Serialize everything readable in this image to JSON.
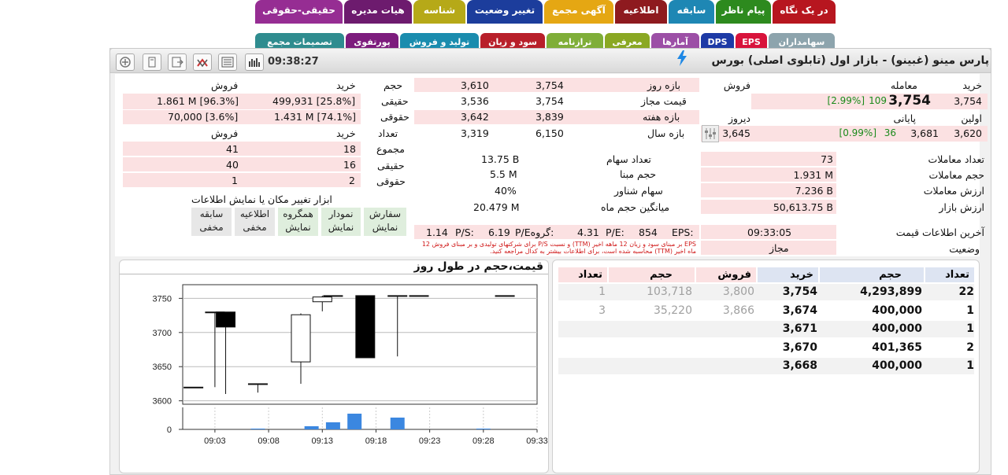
{
  "tabs_row1": [
    {
      "label": "در یک نگاه",
      "color": "#b7161f"
    },
    {
      "label": "پیام ناظر",
      "color": "#2d8a1e"
    },
    {
      "label": "سابقه",
      "color": "#1e87b4"
    },
    {
      "label": "اطلاعیه",
      "color": "#8e1a1f"
    },
    {
      "label": "آگهی مجمع",
      "color": "#e5a713"
    },
    {
      "label": "تغییر وضعیت",
      "color": "#1c3d9c"
    },
    {
      "label": "شناسه",
      "color": "#b6a918"
    },
    {
      "label": "هیات مدیره",
      "color": "#6d1b6e"
    },
    {
      "label": "حقیقی-حقوقی",
      "color": "#962d93"
    }
  ],
  "tabs_row2": [
    {
      "label": "سهامداران",
      "color": "#8da4ad"
    },
    {
      "label": "EPS",
      "color": "#d8133b"
    },
    {
      "label": "DPS",
      "color": "#1d3aa6"
    },
    {
      "label": "آمارها",
      "color": "#9c4fa6"
    },
    {
      "label": "معرفی",
      "color": "#8aa823"
    },
    {
      "label": "ترازنامه",
      "color": "#7fae38"
    },
    {
      "label": "سود و زیان",
      "color": "#b81f2a"
    },
    {
      "label": "تولید و فروش",
      "color": "#1a8cae"
    },
    {
      "label": "پورتفوی",
      "color": "#7d1c7d"
    },
    {
      "label": "تصمیمات مجمع",
      "color": "#2f8c8f"
    }
  ],
  "header": {
    "title": "پارس مینو (غبینو) - بازار اول (تابلوی اصلی) بورس",
    "time": "09:38:27"
  },
  "price_panel": {
    "buy": "خرید",
    "trade": "معامله",
    "sell": "فروش",
    "buy_val": "3,754",
    "trade_val": "3,754",
    "trade_change": "109",
    "trade_pct": "[2.99%]",
    "first": "اولین",
    "closing": "پایانی",
    "yesterday": "دیروز",
    "first_val": "3,620",
    "closing_val": "3,681",
    "closing_change": "36",
    "closing_pct": "[0.99%]",
    "yesterday_val": "3,645"
  },
  "range_panel": {
    "rows": [
      {
        "label": "بازه روز",
        "a": "3,754",
        "b": "3,610"
      },
      {
        "label": "قیمت مجاز",
        "a": "3,754",
        "b": "3,536"
      },
      {
        "label": "بازه هفته",
        "a": "3,839",
        "b": "3,642"
      },
      {
        "label": "بازه سال",
        "a": "6,150",
        "b": "3,319"
      }
    ]
  },
  "volume_header": {
    "volume": "حجم",
    "buy": "خرید",
    "sell": "فروش"
  },
  "real_legal": {
    "real": "حقیقی",
    "legal": "حقوقی",
    "real_buy": "499,931 [25.8%]",
    "real_sell": "1.861 M [96.3%]",
    "legal_buy": "1.431 M [74.1%]",
    "legal_sell": "70,000 [3.6%]"
  },
  "count_table": {
    "count": "تعداد",
    "buy": "خرید",
    "sell": "فروش",
    "rows": [
      {
        "label": "مجموع",
        "buy": "18",
        "sell": "41"
      },
      {
        "label": "حقیقی",
        "buy": "16",
        "sell": "40"
      },
      {
        "label": "حقوقی",
        "buy": "2",
        "sell": "1"
      }
    ]
  },
  "tools": {
    "title": "ابزار تغییر مکان یا نمایش اطلاعات",
    "items": [
      {
        "name": "سفارش",
        "state": "نمایش"
      },
      {
        "name": "نمودار",
        "state": "نمایش"
      },
      {
        "name": "همگروه",
        "state": "نمایش"
      },
      {
        "name": "اطلاعیه",
        "state": "مخفی"
      },
      {
        "name": "سابقه",
        "state": "مخفی"
      }
    ]
  },
  "trade_stats": {
    "rows": [
      {
        "label": "تعداد معاملات",
        "value": "73"
      },
      {
        "label": "حجم معاملات",
        "value": "1.931 M"
      },
      {
        "label": "ارزش معاملات",
        "value": "7.236 B"
      },
      {
        "label": "ارزش بازار",
        "value": "50,613.75 B"
      }
    ]
  },
  "share_stats": {
    "rows": [
      {
        "label": "تعداد سهام",
        "value": "13.75 B"
      },
      {
        "label": "حجم مبنا",
        "value": "5.5 M"
      },
      {
        "label": "سهام شناور",
        "value": "40%"
      },
      {
        "label": "میانگین حجم ماه",
        "value": "20.479 M"
      }
    ]
  },
  "ratios": {
    "eps_label": "EPS:",
    "eps": "854",
    "pe_label": "P/E:",
    "pe": "4.31",
    "gpe_label": "P/Eگروه:",
    "gpe": "6.19",
    "ps_label": "P/S:",
    "ps": "1.14",
    "note": "EPS بر مبنای سود و زیان 12 ماهه اخیر (TTM) و نسبت P/S برای شرکتهای تولیدی و بر مبنای فروش 12 ماه اخیر (TTM) محاسبه شده است، برای اطلاعات بیشتر به کدال مراجعه کنید."
  },
  "status": {
    "last_update_label": "آخرین اطلاعات قیمت",
    "last_update": "09:33:05",
    "state_label": "وضعیت",
    "state": "مجاز"
  },
  "order_book": {
    "headers": {
      "count": "تعداد",
      "volume": "حجم",
      "buy": "خرید",
      "sell": "فروش"
    },
    "rows": [
      {
        "bcount": "22",
        "bvol": "4,293,899",
        "bprice": "3,754",
        "sprice": "3,800",
        "svol": "103,718",
        "scount": "1"
      },
      {
        "bcount": "1",
        "bvol": "400,000",
        "bprice": "3,674",
        "sprice": "3,866",
        "svol": "35,220",
        "scount": "3"
      },
      {
        "bcount": "1",
        "bvol": "400,000",
        "bprice": "3,671",
        "sprice": "",
        "svol": "",
        "scount": ""
      },
      {
        "bcount": "2",
        "bvol": "401,365",
        "bprice": "3,670",
        "sprice": "",
        "svol": "",
        "scount": ""
      },
      {
        "bcount": "1",
        "bvol": "400,000",
        "bprice": "3,668",
        "sprice": "",
        "svol": "",
        "scount": ""
      }
    ]
  },
  "chart_title": "قیمت،حجم در طول روز",
  "chart_data": {
    "type": "candlestick",
    "title": "قیمت،حجم در طول روز",
    "x_ticks": [
      "09:03",
      "09:08",
      "09:13",
      "09:18",
      "09:23",
      "09:28",
      "09:33"
    ],
    "y_ticks": [
      3600,
      3650,
      3700,
      3750
    ],
    "ylim": [
      3595,
      3770
    ],
    "volume_tick": "0",
    "candles": [
      {
        "t": "09:01",
        "o": 3620,
        "h": 3620,
        "l": 3620,
        "c": 3620
      },
      {
        "t": "09:03",
        "o": 3730,
        "h": 3730,
        "l": 3620,
        "c": 3730
      },
      {
        "t": "09:04",
        "o": 3730,
        "h": 3730,
        "l": 3610,
        "c": 3708
      },
      {
        "t": "09:07",
        "o": 3625,
        "h": 3625,
        "l": 3612,
        "c": 3625
      },
      {
        "t": "09:11",
        "o": 3657,
        "h": 3728,
        "l": 3625,
        "c": 3726
      },
      {
        "t": "09:13",
        "o": 3745,
        "h": 3754,
        "l": 3731,
        "c": 3752
      },
      {
        "t": "09:14",
        "o": 3754,
        "h": 3754,
        "l": 3754,
        "c": 3754
      },
      {
        "t": "09:17",
        "o": 3754,
        "h": 3754,
        "l": 3663,
        "c": 3663
      },
      {
        "t": "09:20",
        "o": 3754,
        "h": 3754,
        "l": 3665,
        "c": 3754
      },
      {
        "t": "09:22",
        "o": 3754,
        "h": 3754,
        "l": 3754,
        "c": 3754
      },
      {
        "t": "09:30",
        "o": 3754,
        "h": 3754,
        "l": 3754,
        "c": 3754
      }
    ],
    "volumes": [
      {
        "t": "09:07",
        "v": 0.05
      },
      {
        "t": "09:12",
        "v": 0.2
      },
      {
        "t": "09:14",
        "v": 0.45
      },
      {
        "t": "09:16",
        "v": 1.0
      },
      {
        "t": "09:20",
        "v": 0.75
      },
      {
        "t": "09:28",
        "v": 0.05
      }
    ]
  }
}
